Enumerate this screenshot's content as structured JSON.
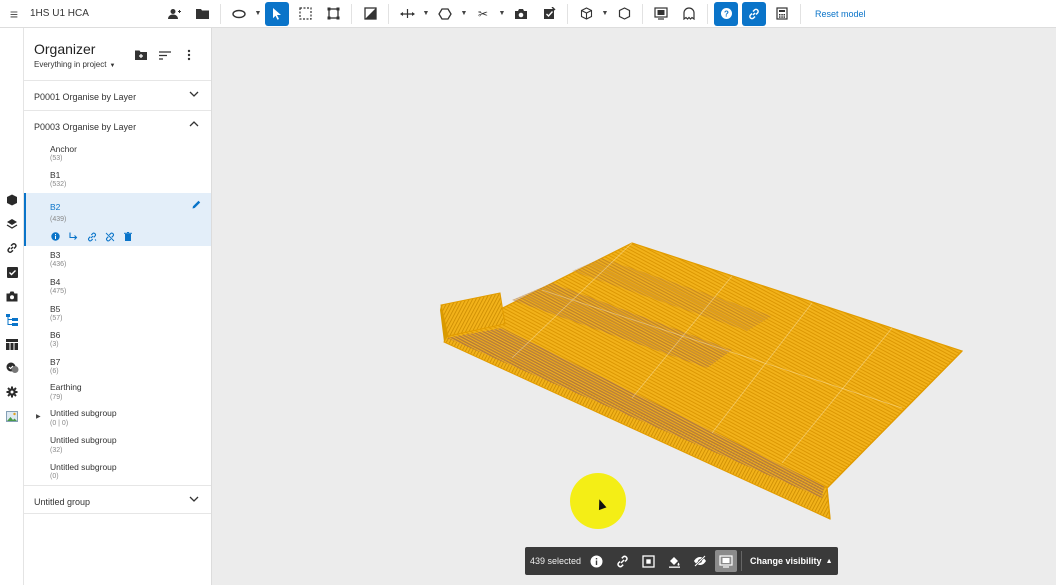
{
  "topbar": {
    "menu_icon": "menu-icon",
    "title": "1HS U1 HCA",
    "reset_label": "Reset model",
    "accent": "#0a74c9"
  },
  "organizer": {
    "title": "Organizer",
    "subtitle": "Everything in project",
    "groups": [
      {
        "label": "P0001 Organise by Layer",
        "expanded": false
      },
      {
        "label": "P0003 Organise by Layer",
        "expanded": true
      },
      {
        "label": "Untitled group",
        "expanded": false
      }
    ],
    "items": [
      {
        "name": "Anchor",
        "count": "(53)"
      },
      {
        "name": "B1",
        "count": "(532)"
      },
      {
        "name": "B2",
        "count": "(439)",
        "selected": true
      },
      {
        "name": "B3",
        "count": "(436)"
      },
      {
        "name": "B4",
        "count": "(475)"
      },
      {
        "name": "B5",
        "count": "(57)"
      },
      {
        "name": "B6",
        "count": "(3)"
      },
      {
        "name": "B7",
        "count": "(6)"
      },
      {
        "name": "Earthing",
        "count": "(79)"
      },
      {
        "name": "Untitled subgroup",
        "count": "(0 | 0)"
      },
      {
        "name": "Untitled subgroup",
        "count": "(32)"
      },
      {
        "name": "Untitled subgroup",
        "count": "(0)"
      }
    ]
  },
  "selection_bar": {
    "count_label": "439 selected",
    "change_label": "Change visibility"
  },
  "model_colors": {
    "fill": "#f2b21a",
    "shade": "#8e5a3a",
    "edge": "#e29c00"
  }
}
